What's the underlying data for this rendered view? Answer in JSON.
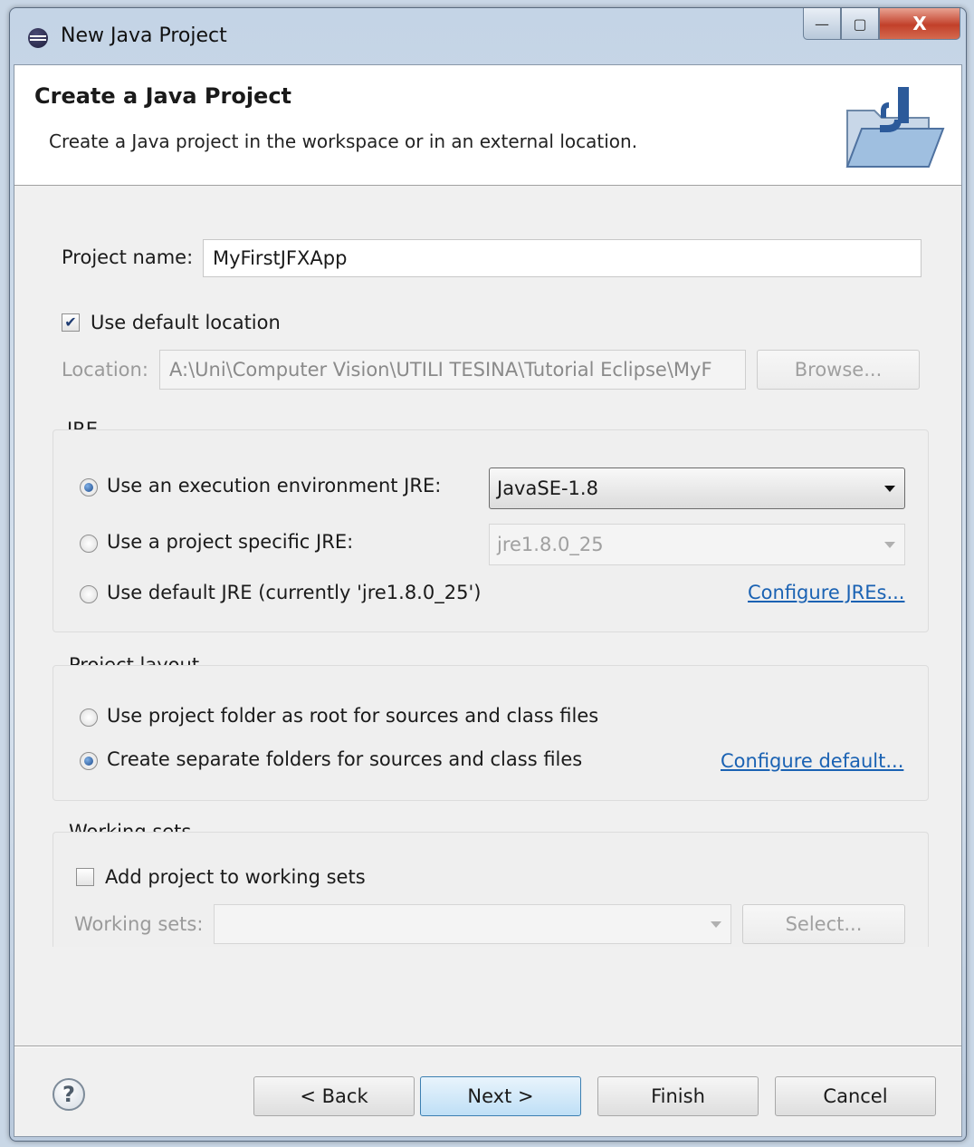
{
  "window": {
    "title": "New Java Project",
    "minimize_glyph": "—",
    "maximize_glyph": "▢",
    "close_glyph": "X"
  },
  "header": {
    "title": "Create a Java Project",
    "description": "Create a Java project in the workspace or in an external location.",
    "icon": "java-project-folder-icon"
  },
  "project": {
    "name_label": "Project name:",
    "name_value": "MyFirstJFXApp",
    "use_default_location_label": "Use default location",
    "use_default_location_checked": true,
    "location_label": "Location:",
    "location_value": "A:\\Uni\\Computer Vision\\UTILI TESINA\\Tutorial Eclipse\\MyF",
    "browse_label": "Browse..."
  },
  "jre": {
    "group_label": "JRE",
    "exec_env_label": "Use an execution environment JRE:",
    "exec_env_value": "JavaSE-1.8",
    "project_specific_label": "Use a project specific JRE:",
    "project_specific_value": "jre1.8.0_25",
    "default_jre_label": "Use default JRE (currently 'jre1.8.0_25')",
    "configure_link": "Configure JREs...",
    "selected": "exec_env"
  },
  "layout": {
    "group_label": "Project layout",
    "root_label": "Use project folder as root for sources and class files",
    "separate_label": "Create separate folders for sources and class files",
    "configure_link": "Configure default...",
    "selected": "separate"
  },
  "working_sets": {
    "group_label": "Working sets",
    "add_label": "Add project to working sets",
    "add_checked": false,
    "sets_label": "Working sets:",
    "sets_value": "",
    "select_label": "Select..."
  },
  "footer": {
    "help_glyph": "?",
    "back_label": "< Back",
    "next_label": "Next >",
    "finish_label": "Finish",
    "cancel_label": "Cancel"
  },
  "colors": {
    "link": "#1a62b3",
    "primary_button_border": "#3c7fb1",
    "close_button": "#c2402a"
  }
}
